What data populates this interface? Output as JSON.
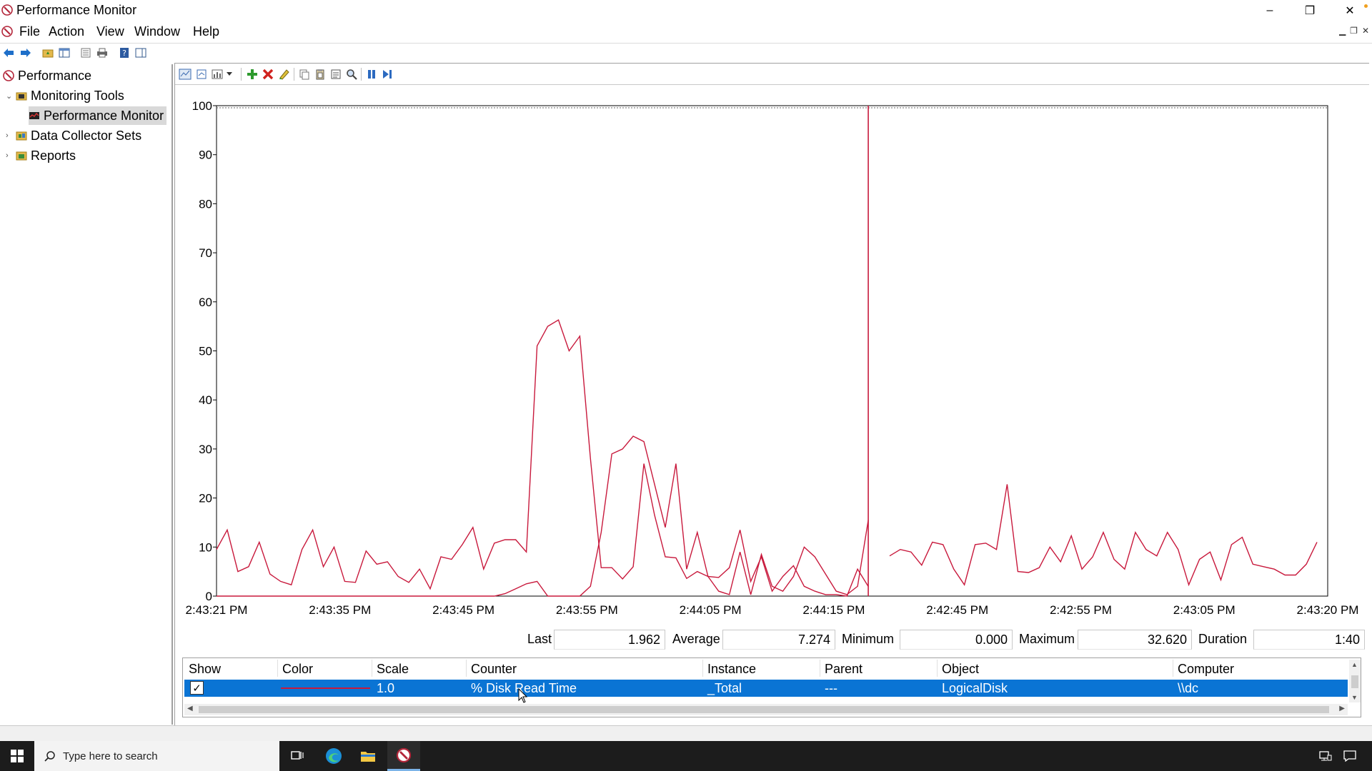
{
  "window": {
    "title": "Performance Monitor",
    "minimize_glyph": "–",
    "restore_glyph": "❐",
    "close_glyph": "✕"
  },
  "menu": [
    "File",
    "Action",
    "View",
    "Window",
    "Help"
  ],
  "tree": {
    "root": "Performance",
    "monitoring_tools": "Monitoring Tools",
    "performance_monitor": "Performance Monitor",
    "data_collector_sets": "Data Collector Sets",
    "reports": "Reports"
  },
  "stats": {
    "last_label": "Last",
    "last_value": "1.962",
    "average_label": "Average",
    "average_value": "7.274",
    "minimum_label": "Minimum",
    "minimum_value": "0.000",
    "maximum_label": "Maximum",
    "maximum_value": "32.620",
    "duration_label": "Duration",
    "duration_value": "1:40"
  },
  "table": {
    "headers": [
      "Show",
      "Color",
      "Scale",
      "Counter",
      "Instance",
      "Parent",
      "Object",
      "Computer"
    ],
    "row": {
      "show": true,
      "color": "#c8193c",
      "scale": "1.0",
      "counter": "% Disk Read Time",
      "instance": "_Total",
      "parent": "---",
      "object": "LogicalDisk",
      "computer": "\\\\dc"
    }
  },
  "taskbar": {
    "search_placeholder": "Type here to search"
  },
  "chart_data": {
    "type": "line",
    "ylim": [
      0,
      100
    ],
    "y_ticks": [
      0,
      10,
      20,
      30,
      40,
      50,
      60,
      70,
      80,
      90,
      100
    ],
    "x_tick_labels": [
      "2:43:21 PM",
      "2:43:35 PM",
      "2:43:45 PM",
      "2:43:55 PM",
      "2:44:05 PM",
      "2:44:15 PM",
      "2:42:45 PM",
      "2:42:55 PM",
      "2:43:05 PM",
      "2:43:20 PM"
    ],
    "line_color": "#c8193c",
    "grid": false,
    "current_time_marker_index": 61,
    "series": [
      {
        "values": [
          9.5,
          13.5,
          5,
          6,
          11,
          4.5,
          3,
          2.3,
          9.5,
          13.5,
          6,
          10,
          3,
          2.8,
          9.2,
          6.5,
          7,
          4,
          2.8,
          5.5,
          1.5,
          8,
          7.5,
          10.5,
          14,
          5.5,
          10.8,
          11.5,
          11.5,
          9,
          51,
          55,
          56.3,
          50,
          53,
          28,
          5.8,
          5.8,
          3.5,
          6,
          27,
          16.5,
          8,
          7.8,
          3.6,
          5,
          4,
          1,
          0.3,
          9,
          0.3,
          8.5,
          2,
          1,
          4,
          10,
          8,
          4.5,
          1,
          0.3,
          2,
          15.5,
          null,
          8.2,
          9.5,
          9,
          6.3,
          11,
          10.5,
          5.5,
          2.3,
          10.5,
          10.8,
          9.5,
          22.8,
          5,
          4.8,
          5.8,
          10,
          7,
          12.3,
          5.5,
          8,
          13,
          7.5,
          5.5,
          13,
          9.5,
          8.2,
          13,
          9.5,
          2.3,
          7.5,
          9,
          3.3,
          10.5,
          12,
          6.5,
          6,
          5.5,
          4.3,
          4.3,
          6.5,
          11
        ]
      },
      {
        "values": [
          0,
          0,
          0,
          0,
          0,
          0,
          0,
          0,
          0,
          0,
          0,
          0,
          0,
          0,
          0,
          0,
          0,
          0,
          0,
          0,
          0,
          0,
          0,
          0,
          0,
          0,
          0,
          0.5,
          1.5,
          2.5,
          3,
          0,
          0,
          0,
          0,
          2,
          13,
          29,
          30,
          32.6,
          31.5,
          22.8,
          14,
          27,
          5.5,
          13,
          4,
          3.8,
          5.8,
          13.5,
          3,
          8,
          1,
          4,
          6.2,
          2,
          1,
          0.3,
          0.3,
          0,
          5.5,
          1.962
        ]
      }
    ]
  }
}
